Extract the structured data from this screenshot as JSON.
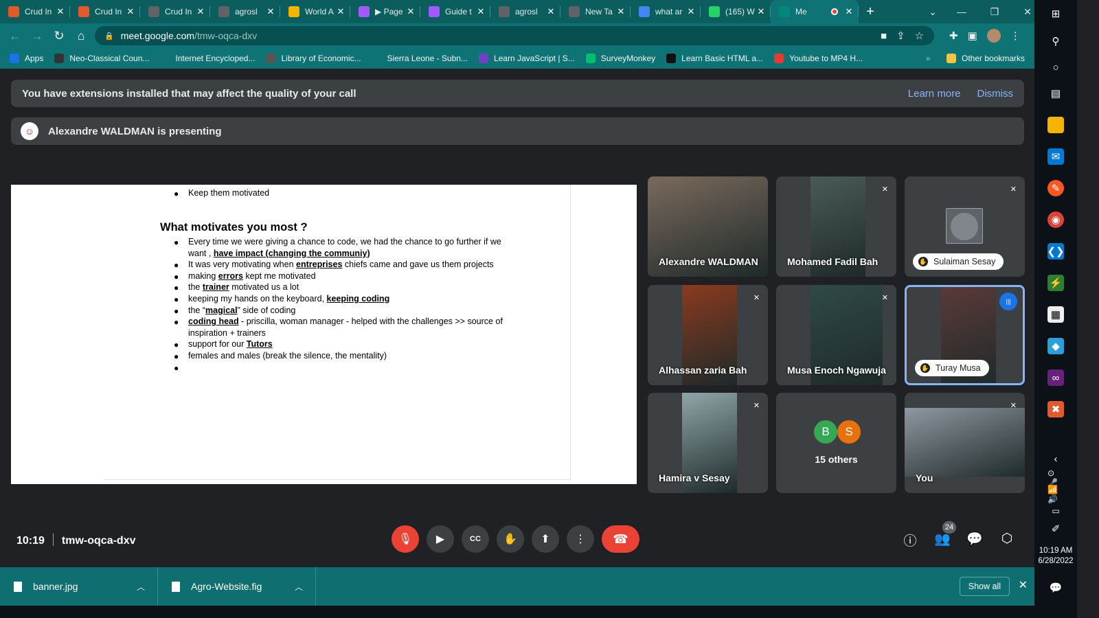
{
  "browser": {
    "tabs": [
      {
        "title": "Crud In",
        "icon": "codeigniter-icon",
        "color": "#e05a2b"
      },
      {
        "title": "Crud In",
        "icon": "codeigniter-icon",
        "color": "#e05a2b"
      },
      {
        "title": "Crud In",
        "icon": "chrome-icon",
        "color": "#5f6368"
      },
      {
        "title": "agrosl",
        "icon": "chrome-icon",
        "color": "#5f6368"
      },
      {
        "title": "World A",
        "icon": "sheet-icon",
        "color": "#f4b400"
      },
      {
        "title": "▶ Page",
        "icon": "figma-icon",
        "color": "#a259ff"
      },
      {
        "title": "Guide t",
        "icon": "figma-icon",
        "color": "#a259ff"
      },
      {
        "title": "agrosl",
        "icon": "chrome-icon",
        "color": "#5f6368"
      },
      {
        "title": "New Ta",
        "icon": "chrome-icon",
        "color": "#5f6368"
      },
      {
        "title": "what ar",
        "icon": "google-icon",
        "color": "#4285f4"
      },
      {
        "title": "(165) W",
        "icon": "whatsapp-icon",
        "color": "#25d366"
      },
      {
        "title": "Me",
        "icon": "meet-icon",
        "color": "#00897b"
      }
    ],
    "url_host": "meet.google.com",
    "url_path": "/tmw-oqca-dxv",
    "bookmarks": [
      {
        "label": "Apps",
        "color": "#1a73e8"
      },
      {
        "label": "Neo-Classical Coun...",
        "color": "#333333"
      },
      {
        "label": "Internet Encycloped...",
        "color": "#0f7375"
      },
      {
        "label": "Library of Economic...",
        "color": "#555555"
      },
      {
        "label": "Sierra Leone - Subn...",
        "color": "#0f7375"
      },
      {
        "label": "Learn JavaScript | S...",
        "color": "#6f42c1"
      },
      {
        "label": "SurveyMonkey",
        "color": "#00bf6f"
      },
      {
        "label": "Learn Basic HTML a...",
        "color": "#111111"
      },
      {
        "label": "Youtube to MP4 H...",
        "color": "#e53935"
      }
    ],
    "bookmarks_overflow": "»",
    "other_bookmarks": "Other bookmarks"
  },
  "meet": {
    "extension_warning": "You have extensions installed that may affect the quality of your call",
    "learn_more": "Learn more",
    "dismiss": "Dismiss",
    "presenting": "Alexandre WALDMAN is presenting",
    "slide": {
      "top_bullet": "Keep them motivated",
      "heading": "What motivates you most ?",
      "lines": [
        {
          "bullet": true,
          "parts": [
            {
              "t": "Every time we were giving a chance to code, we had the chance to go further if we",
              "u": false
            }
          ]
        },
        {
          "bullet": false,
          "parts": [
            {
              "t": "want , ",
              "u": false
            },
            {
              "t": "have impact (changing the communiy)",
              "u": true
            }
          ]
        },
        {
          "bullet": true,
          "parts": [
            {
              "t": "It was very motivating when ",
              "u": false
            },
            {
              "t": "entreprises",
              "u": true
            },
            {
              "t": " chiefs came and gave us them projects",
              "u": false
            }
          ]
        },
        {
          "bullet": true,
          "parts": [
            {
              "t": "making ",
              "u": false
            },
            {
              "t": "errors",
              "u": true
            },
            {
              "t": " kept me motivated",
              "u": false
            }
          ]
        },
        {
          "bullet": true,
          "parts": [
            {
              "t": "the ",
              "u": false
            },
            {
              "t": "trainer",
              "u": true
            },
            {
              "t": " motivated us a lot",
              "u": false
            }
          ]
        },
        {
          "bullet": true,
          "parts": [
            {
              "t": "keeping my hands on the keyboard, ",
              "u": false
            },
            {
              "t": "keeping coding",
              "u": true
            }
          ]
        },
        {
          "bullet": true,
          "parts": [
            {
              "t": "the “",
              "u": false
            },
            {
              "t": "magical",
              "u": true
            },
            {
              "t": "” side of coding",
              "u": false
            }
          ]
        },
        {
          "bullet": true,
          "parts": [
            {
              "t": "coding head",
              "u": true
            },
            {
              "t": " - priscilla, woman manager - helped with the challenges >> source of",
              "u": false
            }
          ]
        },
        {
          "bullet": false,
          "parts": [
            {
              "t": "inspiration + trainers",
              "u": false
            }
          ]
        },
        {
          "bullet": true,
          "parts": [
            {
              "t": "support for our ",
              "u": false
            },
            {
              "t": "Tutors",
              "u": true
            }
          ]
        },
        {
          "bullet": true,
          "parts": [
            {
              "t": "females and males (break the silence, the mentality)",
              "u": false
            }
          ]
        },
        {
          "bullet": true,
          "parts": [
            {
              "t": "",
              "u": false
            }
          ]
        }
      ]
    },
    "participants": [
      {
        "name": "Alexandre WALDMAN",
        "muted": false,
        "style": "name",
        "video": "#7a6a5c"
      },
      {
        "name": "Mohamed Fadil Bah",
        "muted": true,
        "style": "name",
        "video": "#4a5b56"
      },
      {
        "name": "Sulaiman Sesay",
        "muted": true,
        "style": "pill",
        "video": ""
      },
      {
        "name": "Alhassan zaria Bah",
        "muted": true,
        "style": "name",
        "video": "#8a3a1e"
      },
      {
        "name": "Musa Enoch Ngawuja",
        "muted": true,
        "style": "name",
        "video": "#2f4a47"
      },
      {
        "name": "Turay Musa",
        "muted": false,
        "style": "pill",
        "video": "#5a3a38",
        "speaking": true
      },
      {
        "name": "Hamira v Sesay",
        "muted": true,
        "style": "name",
        "video": "#8fa6a8"
      },
      {
        "name": "15 others",
        "muted": false,
        "style": "others",
        "video": "",
        "avatars": [
          {
            "letter": "B",
            "color": "#34a853"
          },
          {
            "letter": "S",
            "color": "#e8710a"
          }
        ]
      },
      {
        "name": "You",
        "muted": true,
        "style": "name",
        "video": "#8f98a0"
      }
    ],
    "time": "10:19",
    "meeting_code": "tmw-oqca-dxv",
    "people_count": "24"
  },
  "downloads": {
    "files": [
      "banner.jpg",
      "Agro-Website.fig"
    ],
    "show_all": "Show all"
  },
  "system": {
    "time": "10:19 AM",
    "date": "6/28/2022"
  }
}
